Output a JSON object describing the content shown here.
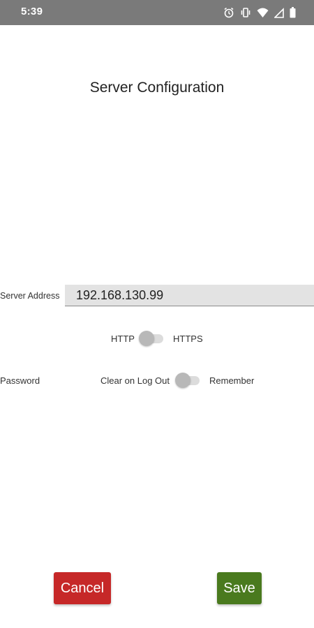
{
  "status_bar": {
    "time": "5:39",
    "background": "#7a7a7a",
    "icons": [
      "alarm-icon",
      "vibrate-icon",
      "wifi-icon",
      "signal-icon",
      "battery-icon"
    ]
  },
  "page": {
    "title": "Server Configuration"
  },
  "server": {
    "label": "Server Address",
    "value": "192.168.130.99"
  },
  "protocol": {
    "left_label": "HTTP",
    "right_label": "HTTPS",
    "switch_on": false
  },
  "password": {
    "label": "Password",
    "left_label": "Clear on Log Out",
    "right_label": "Remember",
    "switch_on": false
  },
  "actions": {
    "cancel_label": "Cancel",
    "save_label": "Save",
    "cancel_color": "#c62828",
    "save_color": "#4a7a1e"
  }
}
